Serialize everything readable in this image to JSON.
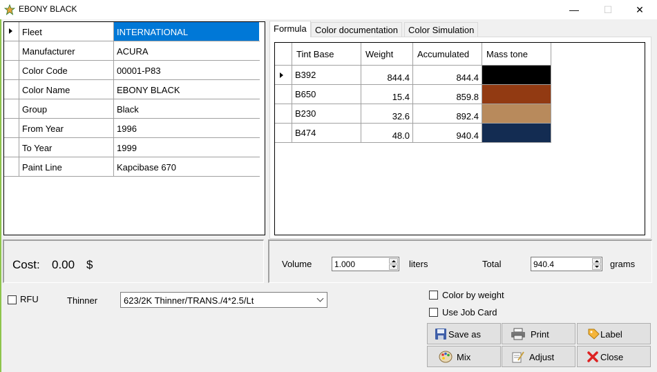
{
  "window": {
    "title": "EBONY BLACK",
    "minimize_glyph": "—",
    "maximize_glyph": "☐",
    "close_glyph": "✕"
  },
  "properties": [
    {
      "name": "Fleet",
      "value": "INTERNATIONAL"
    },
    {
      "name": "Manufacturer",
      "value": "ACURA"
    },
    {
      "name": "Color Code",
      "value": "00001-P83"
    },
    {
      "name": "Color Name",
      "value": "EBONY BLACK"
    },
    {
      "name": "Group",
      "value": "Black"
    },
    {
      "name": "From Year",
      "value": "1996"
    },
    {
      "name": "To Year",
      "value": "1999"
    },
    {
      "name": "Paint Line",
      "value": "Kapcibase 670"
    }
  ],
  "tabs": [
    "Formula",
    "Color documentation",
    "Color Simulation"
  ],
  "formula": {
    "headers": [
      "Tint Base",
      "Weight",
      "Accumulated",
      "Mass tone"
    ],
    "rows": [
      {
        "tint_base": "B392",
        "weight": "844.4",
        "accumulated": "844.4",
        "mass_tone_color": "#000000"
      },
      {
        "tint_base": "B650",
        "weight": "15.4",
        "accumulated": "859.8",
        "mass_tone_color": "#923a12"
      },
      {
        "tint_base": "B230",
        "weight": "32.6",
        "accumulated": "892.4",
        "mass_tone_color": "#b88a5c"
      },
      {
        "tint_base": "B474",
        "weight": "48.0",
        "accumulated": "940.4",
        "mass_tone_color": "#132c52"
      }
    ]
  },
  "cost": {
    "label": "Cost:",
    "value": "0.00",
    "currency": "$"
  },
  "volume": {
    "label": "Volume",
    "value": "1.000",
    "unit": "liters"
  },
  "total": {
    "label": "Total",
    "value": "940.4",
    "unit": "grams"
  },
  "rfu": {
    "label": "RFU",
    "checked": false
  },
  "thinner": {
    "label": "Thinner",
    "value": "623/2K Thinner/TRANS./4*2.5/Lt"
  },
  "options": {
    "color_by_weight": {
      "label": "Color by weight",
      "checked": false
    },
    "use_job_card": {
      "label": "Use Job Card",
      "checked": false
    }
  },
  "buttons": {
    "save_as": {
      "label": "Save as",
      "icon": "floppy-disk-icon"
    },
    "print": {
      "label": "Print",
      "icon": "printer-icon"
    },
    "label": {
      "label": "Label",
      "icon": "tag-icon"
    },
    "mix": {
      "label": "Mix",
      "icon": "palette-icon"
    },
    "adjust": {
      "label": "Adjust",
      "icon": "pencil-note-icon"
    },
    "close": {
      "label": "Close",
      "icon": "red-x-icon"
    }
  },
  "colors": {
    "selection": "#0078d7",
    "window_bg": "#f0f0f0",
    "accent_edge": "#8ec44b"
  }
}
